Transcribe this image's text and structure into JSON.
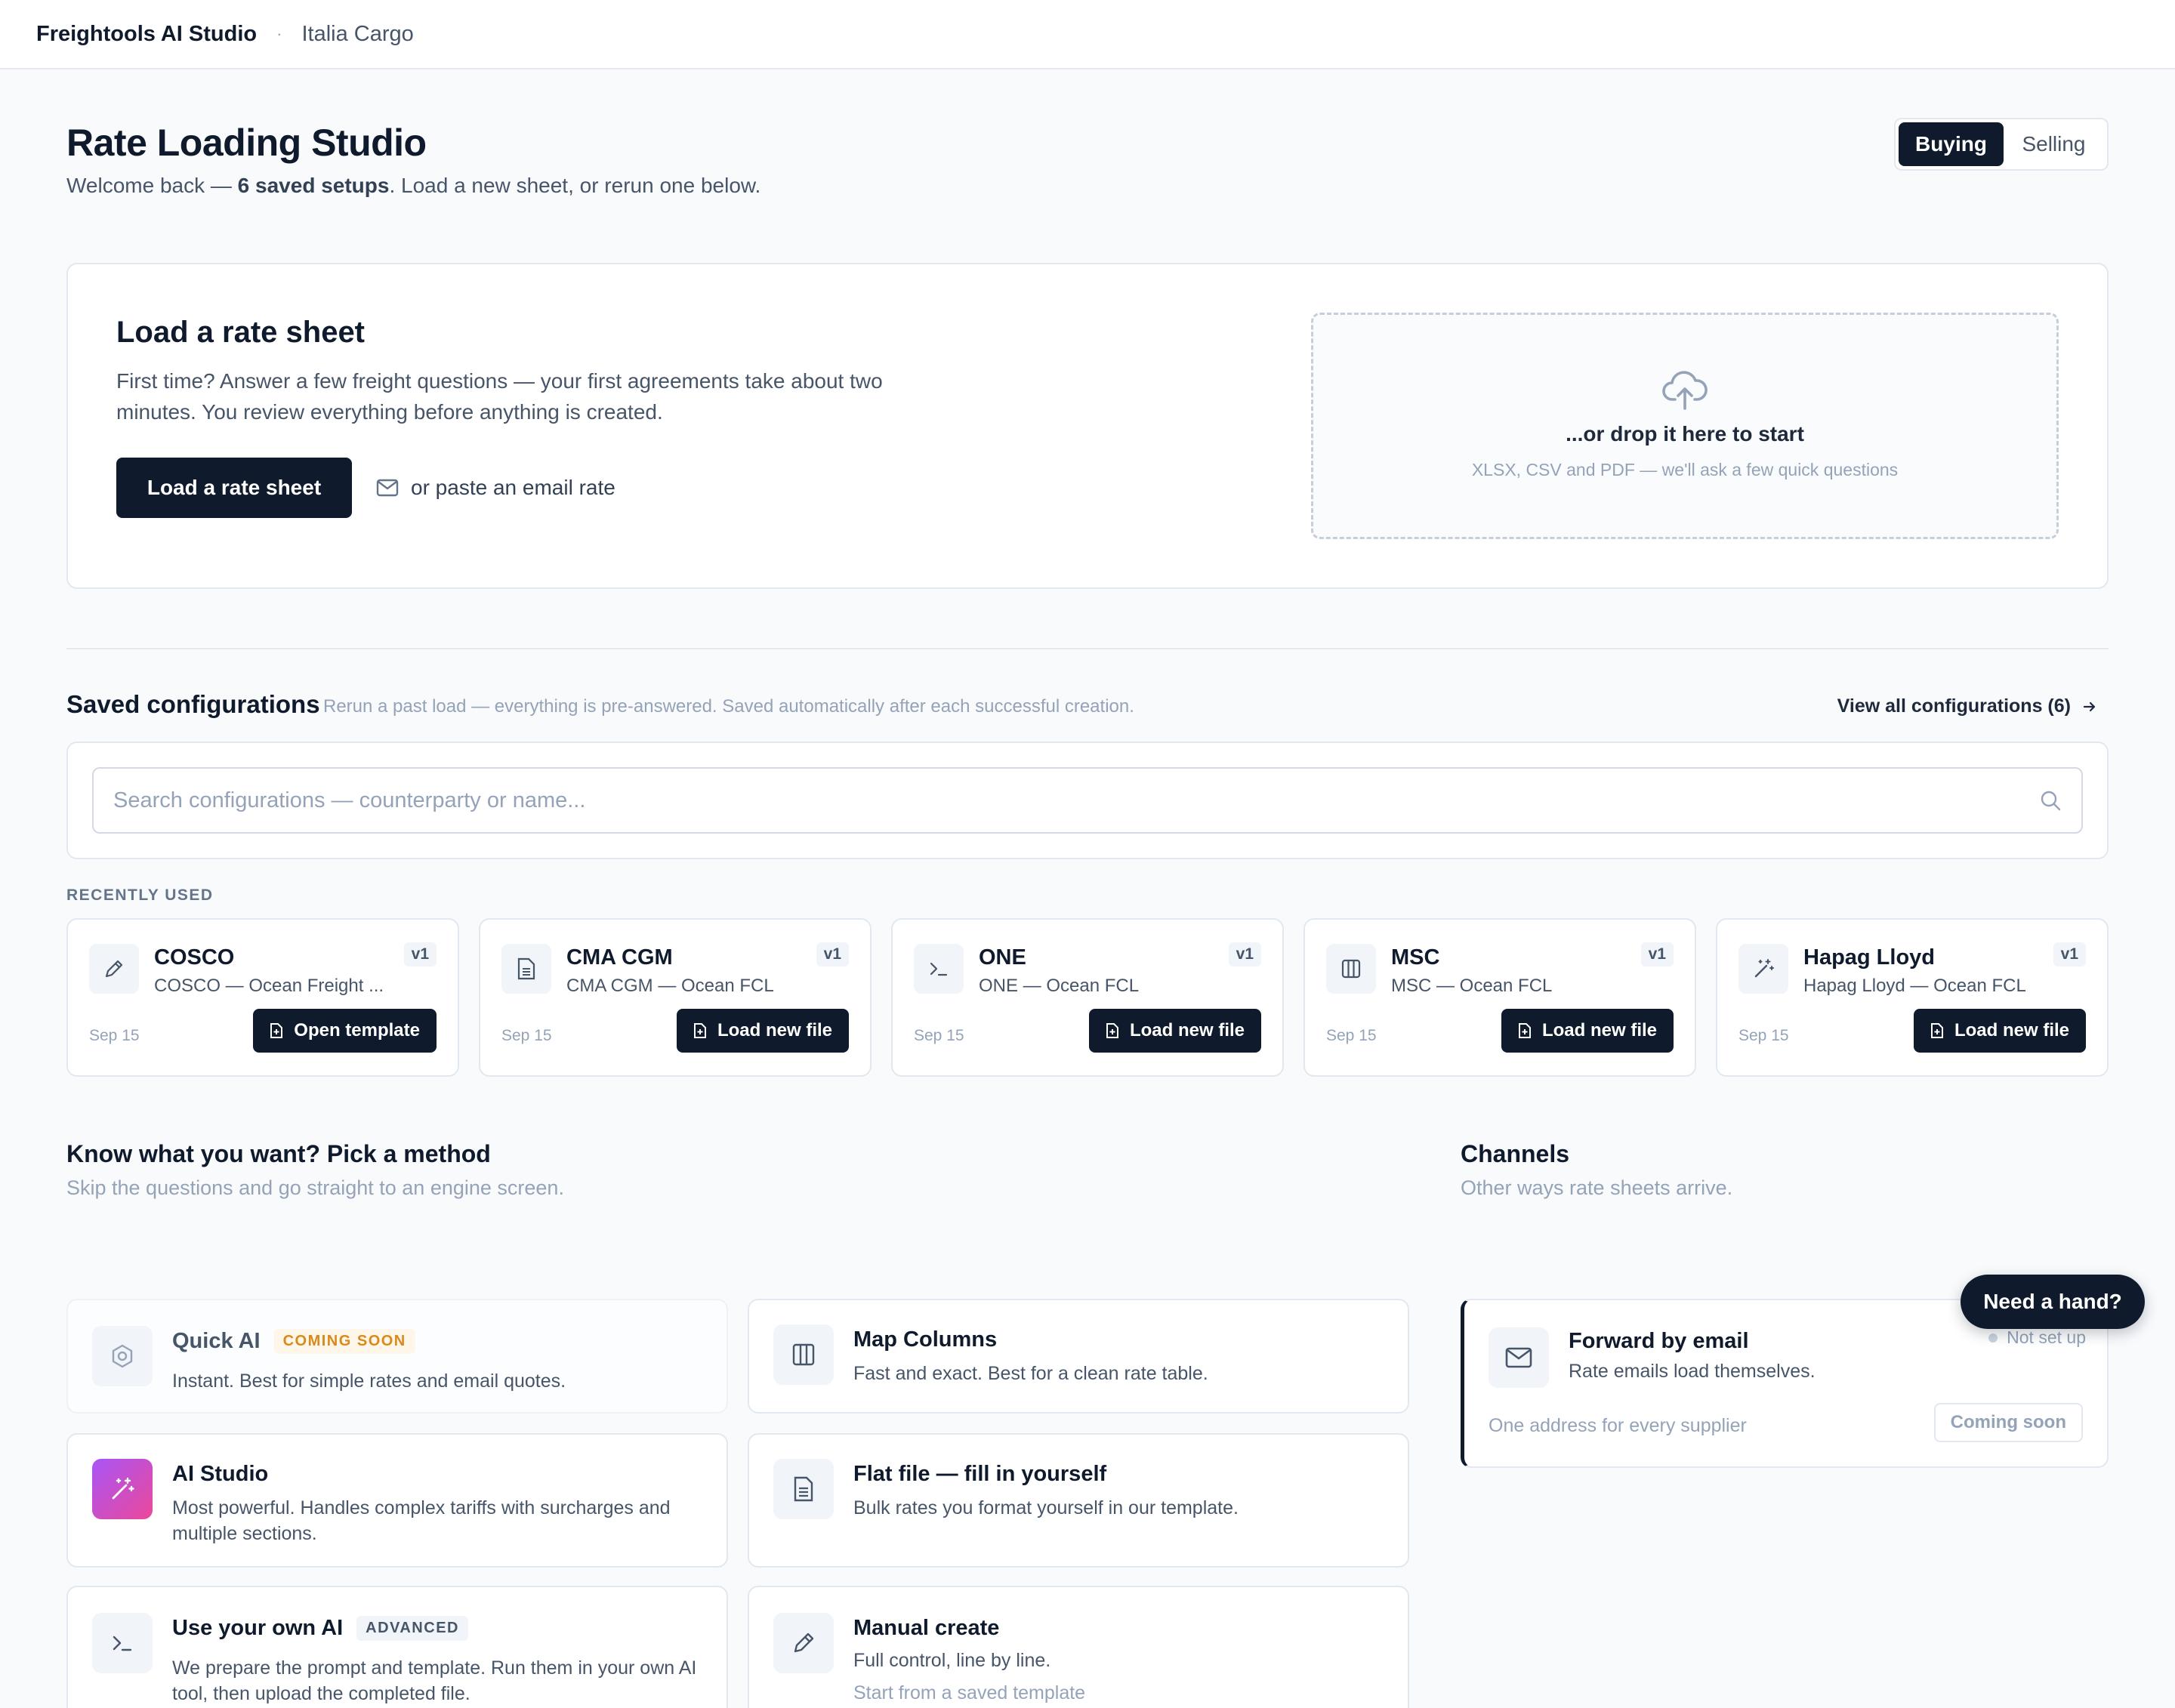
{
  "topbar": {
    "brand": "Freightools AI Studio",
    "separator": "·",
    "org": "Italia Cargo"
  },
  "page": {
    "title": "Rate Loading Studio",
    "subtitle_prefix": "Welcome back — ",
    "subtitle_bold": "6 saved setups",
    "subtitle_suffix": ". Load a new sheet, or rerun one below."
  },
  "mode_toggle": {
    "buying": "Buying",
    "selling": "Selling",
    "selected": "Buying"
  },
  "load_card": {
    "title": "Load a rate sheet",
    "description": "First time? Answer a few freight questions — your first agreements take about two minutes. You review everything before anything is created.",
    "button": "Load a rate sheet",
    "paste_link": "or paste an email rate",
    "drop_title": "...or drop it here to start",
    "drop_sub": "XLSX, CSV and PDF — we'll ask a few quick questions"
  },
  "saved": {
    "title": "Saved configurations",
    "subtitle": "Rerun a past load — everything is pre-answered. Saved automatically after each successful creation.",
    "view_all": "View all configurations (6)",
    "search_placeholder": "Search configurations — counterparty or name...",
    "search_value": "",
    "recent_label": "RECENTLY USED",
    "items": [
      {
        "name": "COSCO",
        "desc": "COSCO — Ocean Freight ...",
        "version": "v1",
        "date": "Sep 15",
        "action": "Open template",
        "icon": "pencil-icon"
      },
      {
        "name": "CMA CGM",
        "desc": "CMA CGM — Ocean FCL",
        "version": "v1",
        "date": "Sep 15",
        "action": "Load new file",
        "icon": "file-spreadsheet-icon"
      },
      {
        "name": "ONE",
        "desc": "ONE — Ocean FCL",
        "version": "v1",
        "date": "Sep 15",
        "action": "Load new file",
        "icon": "terminal-icon"
      },
      {
        "name": "MSC",
        "desc": "MSC — Ocean FCL",
        "version": "v1",
        "date": "Sep 15",
        "action": "Load new file",
        "icon": "columns-icon"
      },
      {
        "name": "Hapag Lloyd",
        "desc": "Hapag Lloyd — Ocean FCL",
        "version": "v1",
        "date": "Sep 15",
        "action": "Load new file",
        "icon": "magic-wand-icon"
      }
    ]
  },
  "methods": {
    "title": "Know what you want? Pick a method",
    "subtitle": "Skip the questions and go straight to an engine screen.",
    "items": [
      {
        "title": "Quick AI",
        "badge": "COMING SOON",
        "desc": "Instant. Best for simple rates and email quotes.",
        "icon": "hexagon-icon"
      },
      {
        "title": "Map Columns",
        "desc": "Fast and exact. Best for a clean rate table.",
        "icon": "columns-icon"
      },
      {
        "title": "AI Studio",
        "desc": "Most powerful. Handles complex tariffs with surcharges and multiple sections.",
        "icon": "magic-wand-icon"
      },
      {
        "title": "Flat file — fill in yourself",
        "desc": "Bulk rates you format yourself in our template.",
        "icon": "file-spreadsheet-icon"
      },
      {
        "title": "Use your own AI",
        "badge": "ADVANCED",
        "desc": "We prepare the prompt and template. Run them in your own AI tool, then upload the completed file.",
        "icon": "terminal-icon"
      },
      {
        "title": "Manual create",
        "desc": "Full control, line by line.",
        "extra": "Start from a saved template",
        "icon": "pencil-icon"
      }
    ]
  },
  "channels": {
    "title": "Channels",
    "subtitle": "Other ways rate sheets arrive.",
    "email": {
      "title": "Forward by email",
      "desc": "Rate emails load themselves.",
      "status": "Not set up",
      "footer": "One address for every supplier",
      "button": "Coming soon",
      "icon": "mail-icon"
    }
  },
  "help_button": "Need a hand?",
  "colors": {
    "primary": "#0f1b2d",
    "muted": "#94a3b8",
    "soon": "#d98a1c",
    "gradient_from": "#a855f7",
    "gradient_to": "#ec4899"
  }
}
